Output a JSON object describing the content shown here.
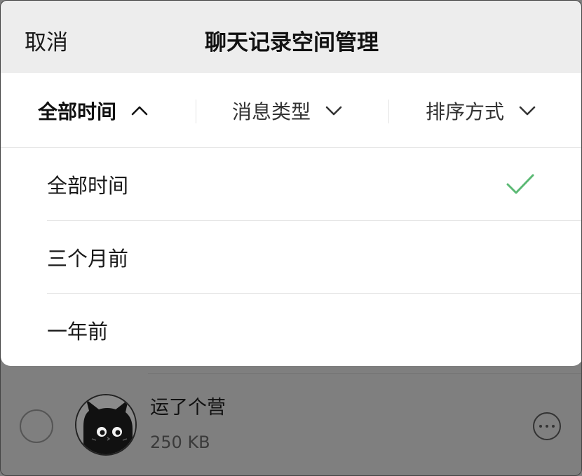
{
  "header": {
    "cancel_label": "取消",
    "title": "聊天记录空间管理"
  },
  "filters": [
    {
      "label": "全部时间",
      "state": "expanded"
    },
    {
      "label": "消息类型",
      "state": "collapsed"
    },
    {
      "label": "排序方式",
      "state": "collapsed"
    }
  ],
  "time_options": [
    {
      "label": "全部时间",
      "selected": true
    },
    {
      "label": "三个月前",
      "selected": false
    },
    {
      "label": "一年前",
      "selected": false
    }
  ],
  "list": {
    "items": [
      {
        "name": "运了个营",
        "size": "250 KB"
      }
    ]
  },
  "icons": {
    "filter_expanded": "chevron-up-icon",
    "filter_collapsed": "chevron-down-icon",
    "selected": "checkmark-icon",
    "row_more": "more-options-icon",
    "row_select": "radio-circle-icon"
  },
  "colors": {
    "header_bg": "#ededed",
    "sheet_bg": "#ffffff",
    "check": "#5bb974",
    "overlay": "#7f7f7f"
  }
}
